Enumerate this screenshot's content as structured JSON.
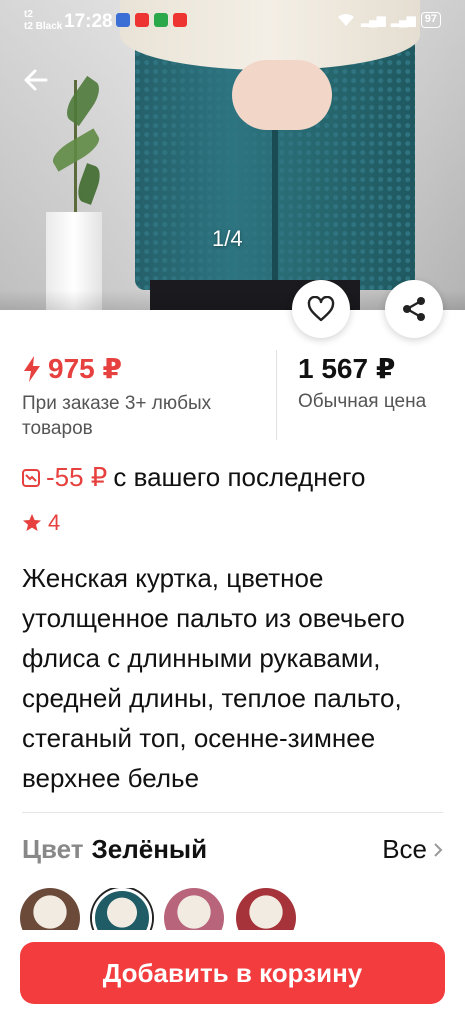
{
  "status_bar": {
    "carrier_line1": "t2",
    "carrier_line2": "t2 Black",
    "time": "17:28",
    "battery": "97"
  },
  "gallery": {
    "counter": "1/4"
  },
  "price": {
    "promo_value": "975 ₽",
    "promo_note": "При заказе 3+ любых товаров",
    "regular_value": "1 567 ₽",
    "regular_note": "Обычная цена"
  },
  "discount": {
    "amount": "-55 ₽",
    "text": "с вашего последнего"
  },
  "rating": {
    "value": "4"
  },
  "product": {
    "title": "Женская куртка, цветное утолщенное пальто из овечьего флиса с длинными рукавами, средней длины, теплое пальто, стеганый топ, осенне-зимнее верхнее белье"
  },
  "color_selector": {
    "label": "Цвет",
    "value": "Зелёный",
    "see_all": "Все",
    "swatches": [
      "#6b4a3a",
      "#1f5c66",
      "#b8647a",
      "#a6323a"
    ]
  },
  "actions": {
    "add_to_cart": "Добавить в корзину"
  },
  "colors": {
    "accent": "#e6413e",
    "button": "#f23c3e"
  }
}
